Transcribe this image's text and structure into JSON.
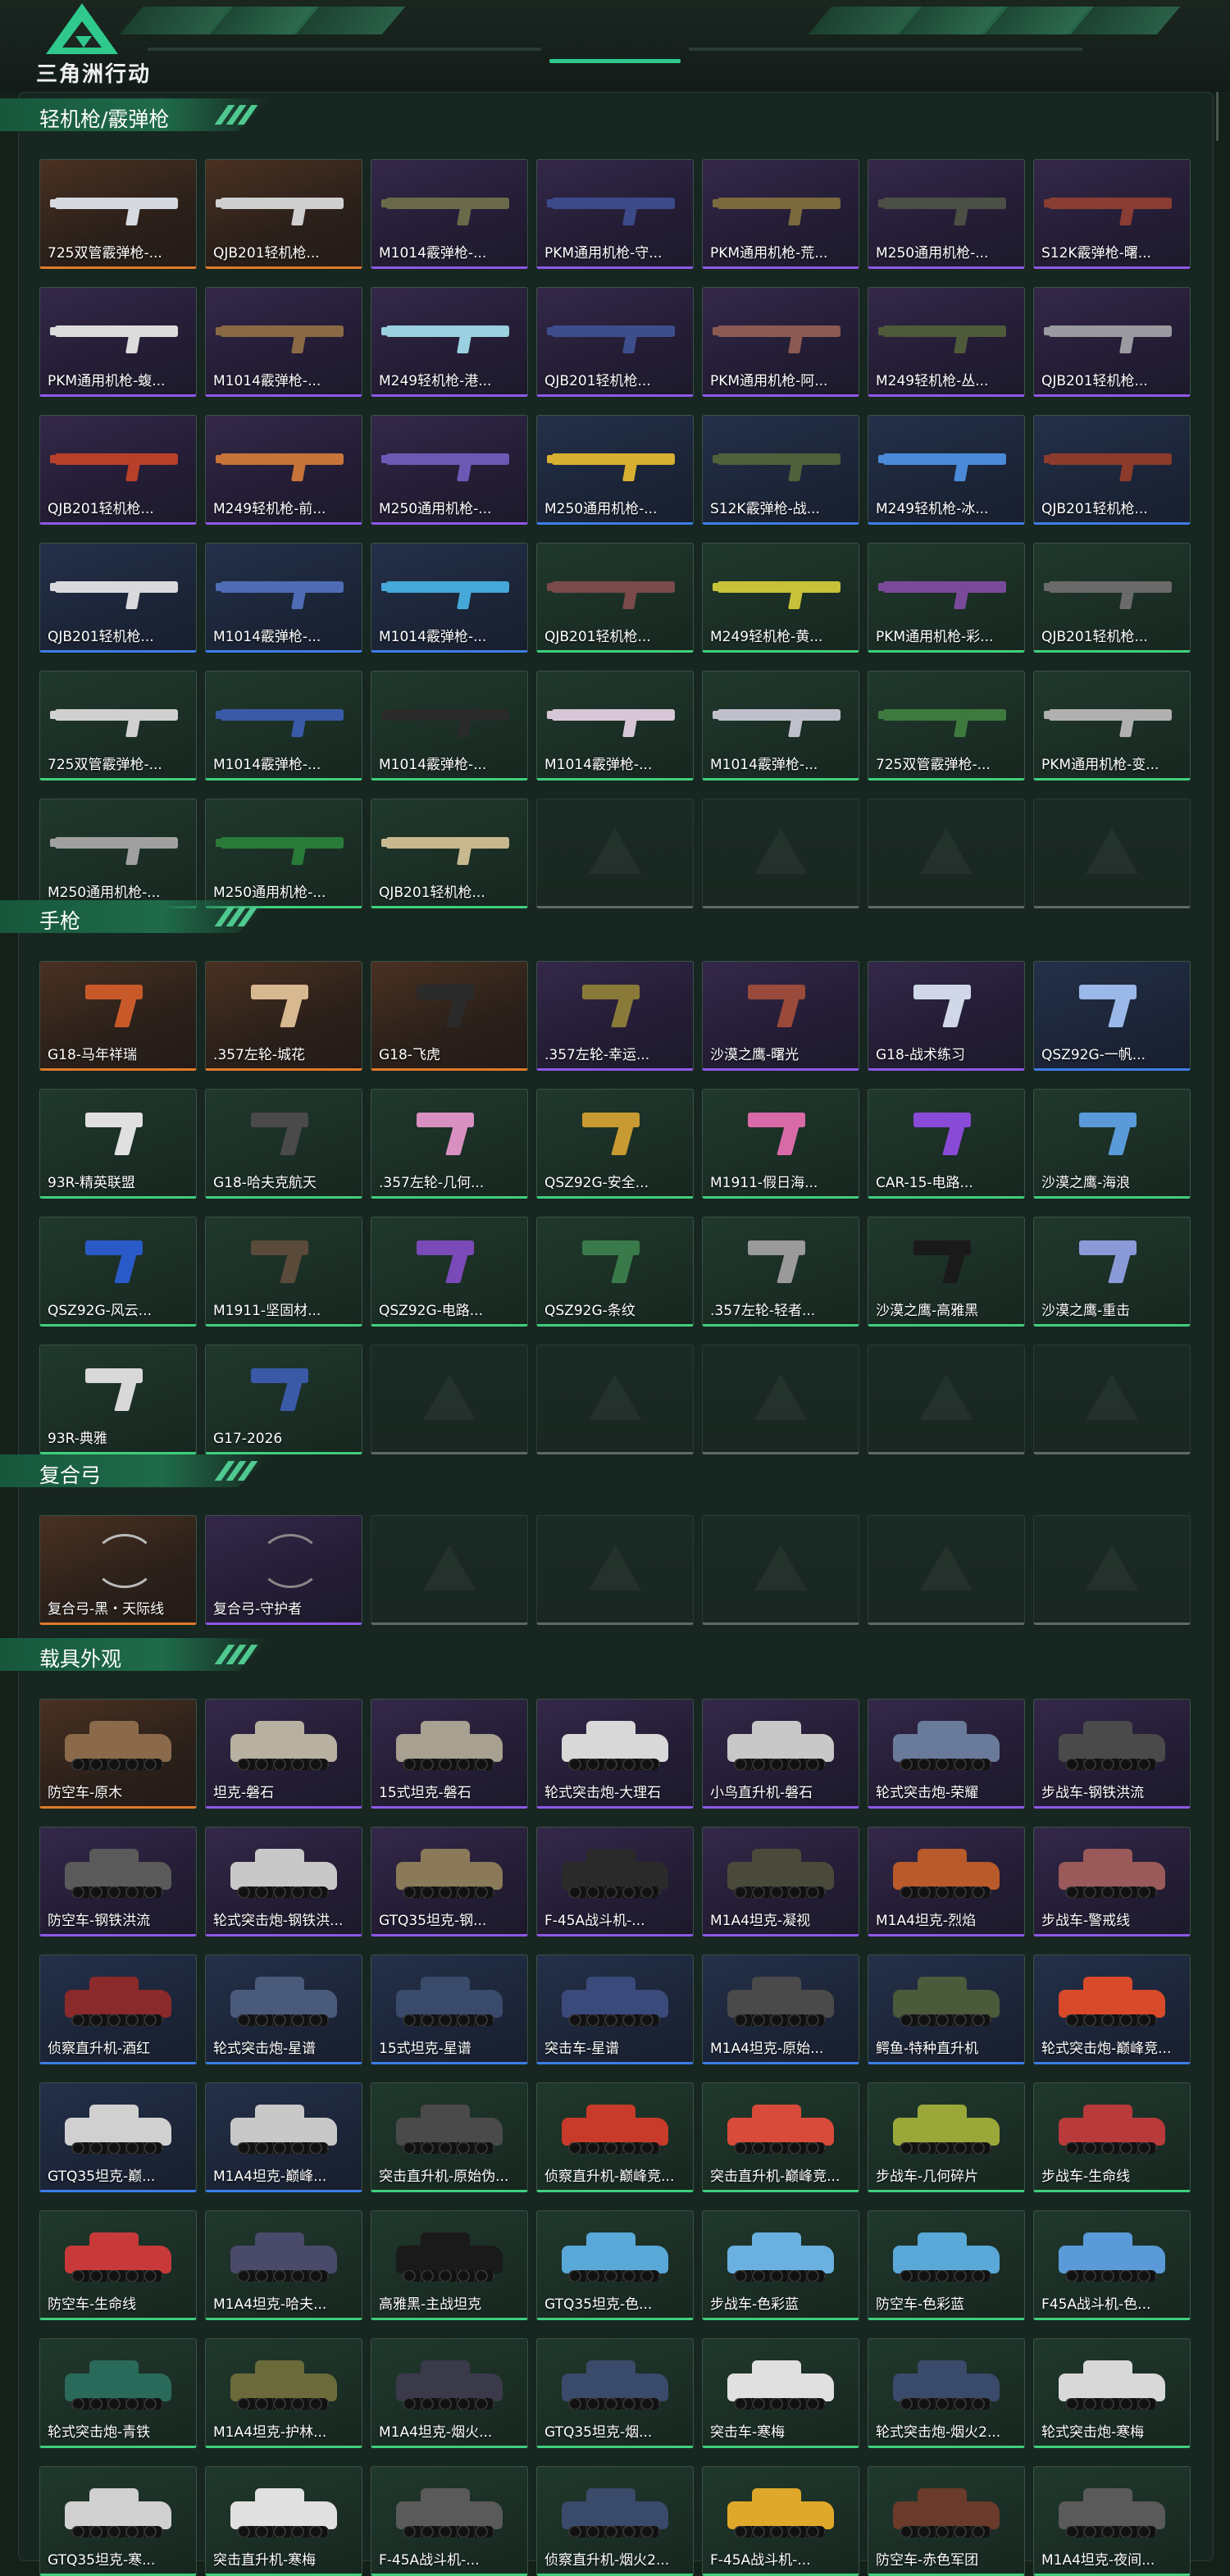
{
  "header": {
    "logo_text": "三角洲行动"
  },
  "colors": {
    "orange": "#e07a29",
    "purple": "#8e58e8",
    "blue": "#3d7de8",
    "green": "#3fcf7f",
    "accent": "#2fc98d"
  },
  "sections": [
    {
      "title": "轻机枪/霰弹枪",
      "kind": "gun",
      "items": [
        {
          "name": "725双管霰弹枪-...",
          "tier": "orange",
          "tint": "#d7d9e0"
        },
        {
          "name": "QJB201轻机枪...",
          "tier": "orange",
          "tint": "#cfcfcf"
        },
        {
          "name": "M1014霰弹枪-...",
          "tier": "purple",
          "tint": "#6a6a4a"
        },
        {
          "name": "PKM通用机枪-守...",
          "tier": "purple",
          "tint": "#3c4a8a"
        },
        {
          "name": "PKM通用机枪-荒...",
          "tier": "purple",
          "tint": "#7b6a3e"
        },
        {
          "name": "M250通用机枪-...",
          "tier": "purple",
          "tint": "#4b4f45"
        },
        {
          "name": "S12K霰弹枪-曙...",
          "tier": "purple",
          "tint": "#8a3d32"
        },
        {
          "name": "PKM通用机枪-蝮...",
          "tier": "purple",
          "tint": "#dcdcdc"
        },
        {
          "name": "M1014霰弹枪-...",
          "tier": "purple",
          "tint": "#8a6a45"
        },
        {
          "name": "M249轻机枪-港...",
          "tier": "purple",
          "tint": "#9ad0e0"
        },
        {
          "name": "QJB201轻机枪...",
          "tier": "purple",
          "tint": "#3e4e8c"
        },
        {
          "name": "PKM通用机枪-阿...",
          "tier": "purple",
          "tint": "#8c5a52"
        },
        {
          "name": "M249轻机枪-丛...",
          "tier": "purple",
          "tint": "#4e5a3a"
        },
        {
          "name": "QJB201轻机枪...",
          "tier": "purple",
          "tint": "#9a9aa0"
        },
        {
          "name": "QJB201轻机枪...",
          "tier": "purple",
          "tint": "#b8402a"
        },
        {
          "name": "M249轻机枪-前...",
          "tier": "purple",
          "tint": "#c6743a"
        },
        {
          "name": "M250通用机枪-...",
          "tier": "purple",
          "tint": "#6a5ab4"
        },
        {
          "name": "M250通用机枪-...",
          "tier": "blue",
          "tint": "#d7b032"
        },
        {
          "name": "S12K霰弹枪-战...",
          "tier": "blue",
          "tint": "#50603a"
        },
        {
          "name": "M249轻机枪-冰...",
          "tier": "blue",
          "tint": "#4a8ad8"
        },
        {
          "name": "QJB201轻机枪...",
          "tier": "blue",
          "tint": "#8c3a2c"
        },
        {
          "name": "QJB201轻机枪...",
          "tier": "blue",
          "tint": "#d9d9dc"
        },
        {
          "name": "M1014霰弹枪-...",
          "tier": "blue",
          "tint": "#4f6cb4"
        },
        {
          "name": "M1014霰弹枪-...",
          "tier": "blue",
          "tint": "#46a8d8"
        },
        {
          "name": "QJB201轻机枪...",
          "tier": "green",
          "tint": "#7a4a4a"
        },
        {
          "name": "M249轻机枪-黄...",
          "tier": "green",
          "tint": "#c8c23a"
        },
        {
          "name": "PKM通用机枪-彩...",
          "tier": "green",
          "tint": "#7a4a9a"
        },
        {
          "name": "QJB201轻机枪...",
          "tier": "green",
          "tint": "#6a6a6a"
        },
        {
          "name": "725双管霰弹枪-...",
          "tier": "green",
          "tint": "#d0d0d0"
        },
        {
          "name": "M1014霰弹枪-...",
          "tier": "green",
          "tint": "#3a5aa8"
        },
        {
          "name": "M1014霰弹枪-...",
          "tier": "green",
          "tint": "#2a2a2a"
        },
        {
          "name": "M1014霰弹枪-...",
          "tier": "green",
          "tint": "#d6c6d6"
        },
        {
          "name": "M1014霰弹枪-...",
          "tier": "green",
          "tint": "#c0c0cc"
        },
        {
          "name": "725双管霰弹枪-...",
          "tier": "green",
          "tint": "#3e7a3e"
        },
        {
          "name": "PKM通用机枪-变...",
          "tier": "green",
          "tint": "#b0b0b0"
        },
        {
          "name": "M250通用机枪-...",
          "tier": "green",
          "tint": "#a0a0a0"
        },
        {
          "name": "M250通用机枪-...",
          "tier": "green",
          "tint": "#2a7a3a"
        },
        {
          "name": "QJB201轻机枪...",
          "tier": "green",
          "tint": "#c8b890"
        },
        {
          "name": "",
          "tier": "empty"
        },
        {
          "name": "",
          "tier": "empty"
        },
        {
          "name": "",
          "tier": "empty"
        },
        {
          "name": "",
          "tier": "empty"
        }
      ]
    },
    {
      "title": "手枪",
      "kind": "pistol",
      "items": [
        {
          "name": "G18-马年祥瑞",
          "tier": "orange",
          "tint": "#c85a2a"
        },
        {
          "name": ".357左轮-城花",
          "tier": "orange",
          "tint": "#d8b890"
        },
        {
          "name": "G18-飞虎",
          "tier": "orange",
          "tint": "#2a2a2a"
        },
        {
          "name": ".357左轮-幸运...",
          "tier": "purple",
          "tint": "#8a7a3a"
        },
        {
          "name": "沙漠之鹰-曙光",
          "tier": "purple",
          "tint": "#9a4a3a"
        },
        {
          "name": "G18-战术练习",
          "tier": "purple",
          "tint": "#d0d8e8"
        },
        {
          "name": "QSZ92G-一帆...",
          "tier": "blue",
          "tint": "#9ab8e8"
        },
        {
          "name": "93R-精英联盟",
          "tier": "green",
          "tint": "#e0e0e0"
        },
        {
          "name": "G18-哈夫克航天",
          "tier": "green",
          "tint": "#4a4a4a"
        },
        {
          "name": ".357左轮-几何...",
          "tier": "green",
          "tint": "#d890c0"
        },
        {
          "name": "QSZ92G-安全...",
          "tier": "green",
          "tint": "#c89a32"
        },
        {
          "name": "M1911-假日海...",
          "tier": "green",
          "tint": "#d86aa8"
        },
        {
          "name": "CAR-15-电路...",
          "tier": "green",
          "tint": "#8a4ad8"
        },
        {
          "name": "沙漠之鹰-海浪",
          "tier": "green",
          "tint": "#5a9ad8"
        },
        {
          "name": "QSZ92G-风云...",
          "tier": "green",
          "tint": "#2a5ac8"
        },
        {
          "name": "M1911-坚固材...",
          "tier": "green",
          "tint": "#5a4a3a"
        },
        {
          "name": "QSZ92G-电路...",
          "tier": "green",
          "tint": "#7a4ab8"
        },
        {
          "name": "QSZ92G-条纹",
          "tier": "green",
          "tint": "#3a7a4a"
        },
        {
          "name": ".357左轮-轻者...",
          "tier": "green",
          "tint": "#9a9a9a"
        },
        {
          "name": "沙漠之鹰-高雅黑",
          "tier": "green",
          "tint": "#1a1a1a"
        },
        {
          "name": "沙漠之鹰-重击",
          "tier": "green",
          "tint": "#8a9ad8"
        },
        {
          "name": "93R-典雅",
          "tier": "green",
          "tint": "#d8d8d8"
        },
        {
          "name": "G17-2026",
          "tier": "green",
          "tint": "#3a5aa8"
        },
        {
          "name": "",
          "tier": "empty"
        },
        {
          "name": "",
          "tier": "empty"
        },
        {
          "name": "",
          "tier": "empty"
        },
        {
          "name": "",
          "tier": "empty"
        },
        {
          "name": "",
          "tier": "empty"
        }
      ]
    },
    {
      "title": "复合弓",
      "kind": "bow",
      "items": [
        {
          "name": "复合弓-黑・天际线",
          "tier": "orange",
          "tint": "#bbbbbb"
        },
        {
          "name": "复合弓-守护者",
          "tier": "purple",
          "tint": "#888888"
        },
        {
          "name": "",
          "tier": "empty"
        },
        {
          "name": "",
          "tier": "empty"
        },
        {
          "name": "",
          "tier": "empty"
        },
        {
          "name": "",
          "tier": "empty"
        },
        {
          "name": "",
          "tier": "empty"
        }
      ]
    },
    {
      "title": "载具外观",
      "kind": "veh",
      "items": [
        {
          "name": "防空车-原木",
          "tier": "orange",
          "tint": "#8a6a4a"
        },
        {
          "name": "坦克-磐石",
          "tier": "purple",
          "tint": "#b8b0a0"
        },
        {
          "name": "15式坦克-磐石",
          "tier": "purple",
          "tint": "#a8a090"
        },
        {
          "name": "轮式突击炮-大理石",
          "tier": "purple",
          "tint": "#d8d8d8"
        },
        {
          "name": "小鸟直升机-磐石",
          "tier": "purple",
          "tint": "#c8c8c8"
        },
        {
          "name": "轮式突击炮-荣耀",
          "tier": "purple",
          "tint": "#6a7a9a"
        },
        {
          "name": "步战车-钢铁洪流",
          "tier": "purple",
          "tint": "#4a4a4a"
        },
        {
          "name": "防空车-钢铁洪流",
          "tier": "purple",
          "tint": "#5a5a5a"
        },
        {
          "name": "轮式突击炮-钢铁洪...",
          "tier": "purple",
          "tint": "#c8c8c8"
        },
        {
          "name": "GTQ35坦克-钢...",
          "tier": "purple",
          "tint": "#8a7a5a"
        },
        {
          "name": "F-45A战斗机-...",
          "tier": "purple",
          "tint": "#2a2a2a"
        },
        {
          "name": "M1A4坦克-凝视",
          "tier": "purple",
          "tint": "#4a4a3a"
        },
        {
          "name": "M1A4坦克-烈焰",
          "tier": "purple",
          "tint": "#b85a2a"
        },
        {
          "name": "步战车-警戒线",
          "tier": "purple",
          "tint": "#9a5a5a"
        },
        {
          "name": "侦察直升机-酒红",
          "tier": "blue",
          "tint": "#8a2a2a"
        },
        {
          "name": "轮式突击炮-星谱",
          "tier": "blue",
          "tint": "#4a5a7a"
        },
        {
          "name": "15式坦克-星谱",
          "tier": "blue",
          "tint": "#3a4a6a"
        },
        {
          "name": "突击车-星谱",
          "tier": "blue",
          "tint": "#3a4a7a"
        },
        {
          "name": "M1A4坦克-原始...",
          "tier": "blue",
          "tint": "#4a4a4a"
        },
        {
          "name": "鳄鱼-特种直升机",
          "tier": "blue",
          "tint": "#4a5a3a"
        },
        {
          "name": "轮式突击炮-巅峰竞...",
          "tier": "blue",
          "tint": "#d84a2a"
        },
        {
          "name": "GTQ35坦克-巅...",
          "tier": "blue",
          "tint": "#d0d0d0"
        },
        {
          "name": "M1A4坦克-巅峰...",
          "tier": "blue",
          "tint": "#c8c8c8"
        },
        {
          "name": "突击直升机-原始伪...",
          "tier": "green",
          "tint": "#4a4a4a"
        },
        {
          "name": "侦察直升机-巅峰竞...",
          "tier": "green",
          "tint": "#c83a2a"
        },
        {
          "name": "突击直升机-巅峰竞...",
          "tier": "green",
          "tint": "#d84a3a"
        },
        {
          "name": "步战车-几何碎片",
          "tier": "green",
          "tint": "#9aa83a"
        },
        {
          "name": "步战车-生命线",
          "tier": "green",
          "tint": "#b83a3a"
        },
        {
          "name": "防空车-生命线",
          "tier": "green",
          "tint": "#c83a3a"
        },
        {
          "name": "M1A4坦克-哈夫...",
          "tier": "green",
          "tint": "#4a4a6a"
        },
        {
          "name": "高雅黑-主战坦克",
          "tier": "green",
          "tint": "#1a1a1a"
        },
        {
          "name": "GTQ35坦克-色...",
          "tier": "green",
          "tint": "#5aa8d8"
        },
        {
          "name": "步战车-色彩蓝",
          "tier": "green",
          "tint": "#6ab0e0"
        },
        {
          "name": "防空车-色彩蓝",
          "tier": "green",
          "tint": "#5aa8d8"
        },
        {
          "name": "F45A战斗机-色...",
          "tier": "green",
          "tint": "#5a9ad8"
        },
        {
          "name": "轮式突击炮-青铁",
          "tier": "green",
          "tint": "#2a6a5a"
        },
        {
          "name": "M1A4坦克-护林...",
          "tier": "green",
          "tint": "#6a6a3a"
        },
        {
          "name": "M1A4坦克-烟火...",
          "tier": "green",
          "tint": "#3a3a4a"
        },
        {
          "name": "GTQ35坦克-烟...",
          "tier": "green",
          "tint": "#3a4a6a"
        },
        {
          "name": "突击车-寒梅",
          "tier": "green",
          "tint": "#e0e0e0"
        },
        {
          "name": "轮式突击炮-烟火2...",
          "tier": "green",
          "tint": "#3a4a6a"
        },
        {
          "name": "轮式突击炮-寒梅",
          "tier": "green",
          "tint": "#d8d8d8"
        },
        {
          "name": "GTQ35坦克-寒...",
          "tier": "green",
          "tint": "#d0d0d0"
        },
        {
          "name": "突击直升机-寒梅",
          "tier": "green",
          "tint": "#e0e0e0"
        },
        {
          "name": "F-45A战斗机-...",
          "tier": "green",
          "tint": "#5a5a5a"
        },
        {
          "name": "侦察直升机-烟火2...",
          "tier": "green",
          "tint": "#3a4a6a"
        },
        {
          "name": "F-45A战斗机-...",
          "tier": "green",
          "tint": "#e0a82a"
        },
        {
          "name": "防空车-赤色军团",
          "tier": "green",
          "tint": "#6a3a2a"
        },
        {
          "name": "M1A4坦克-夜间...",
          "tier": "green",
          "tint": "#5a5a5a"
        }
      ]
    }
  ]
}
